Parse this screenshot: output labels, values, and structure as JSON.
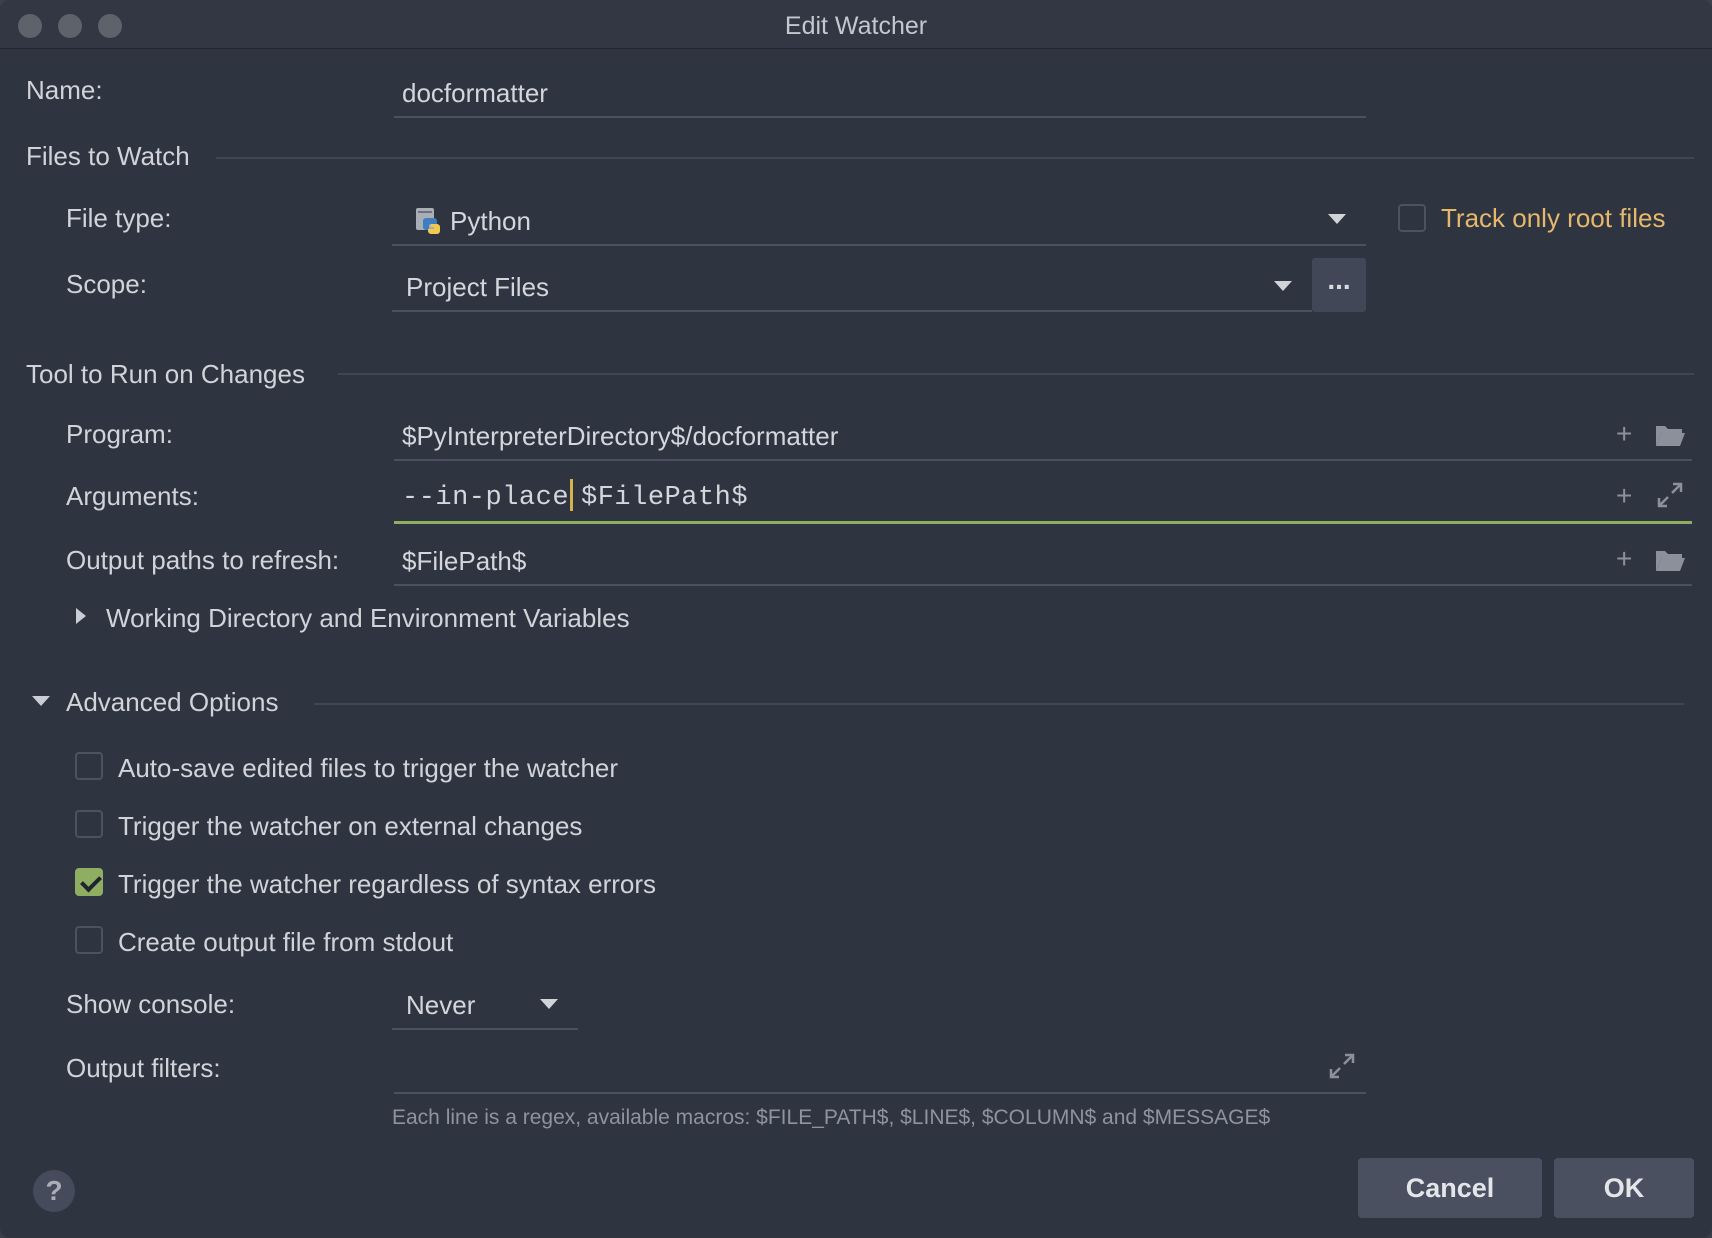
{
  "window": {
    "title": "Edit Watcher"
  },
  "name": {
    "label": "Name:",
    "value": "docformatter"
  },
  "files_to_watch": {
    "section": "Files to Watch",
    "file_type_label": "File type:",
    "file_type_value": "Python",
    "track_root_label": "Track only root files",
    "track_root_checked": false,
    "scope_label": "Scope:",
    "scope_value": "Project Files",
    "scope_more": "..."
  },
  "tool": {
    "section": "Tool to Run on Changes",
    "program_label": "Program:",
    "program_value": "$PyInterpreterDirectory$/docformatter",
    "arguments_label": "Arguments:",
    "arguments_before_cursor": "--in-place",
    "arguments_after_cursor": "$FilePath$",
    "output_paths_label": "Output paths to refresh:",
    "output_paths_value": "$FilePath$",
    "working_dir_label": "Working Directory and Environment Variables"
  },
  "advanced": {
    "section": "Advanced Options",
    "options": [
      {
        "label": "Auto-save edited files to trigger the watcher",
        "checked": false
      },
      {
        "label": "Trigger the watcher on external changes",
        "checked": false
      },
      {
        "label": "Trigger the watcher regardless of syntax errors",
        "checked": true
      },
      {
        "label": "Create output file from stdout",
        "checked": false
      }
    ],
    "show_console_label": "Show console:",
    "show_console_value": "Never",
    "output_filters_label": "Output filters:",
    "output_filters_value": "",
    "hint": "Each line is a regex, available macros: $FILE_PATH$, $LINE$, $COLUMN$ and $MESSAGE$"
  },
  "buttons": {
    "help": "?",
    "cancel": "Cancel",
    "ok": "OK"
  },
  "colors": {
    "accent": "#8fae62",
    "warning_label": "#e6b86a",
    "background": "#2f3441"
  }
}
